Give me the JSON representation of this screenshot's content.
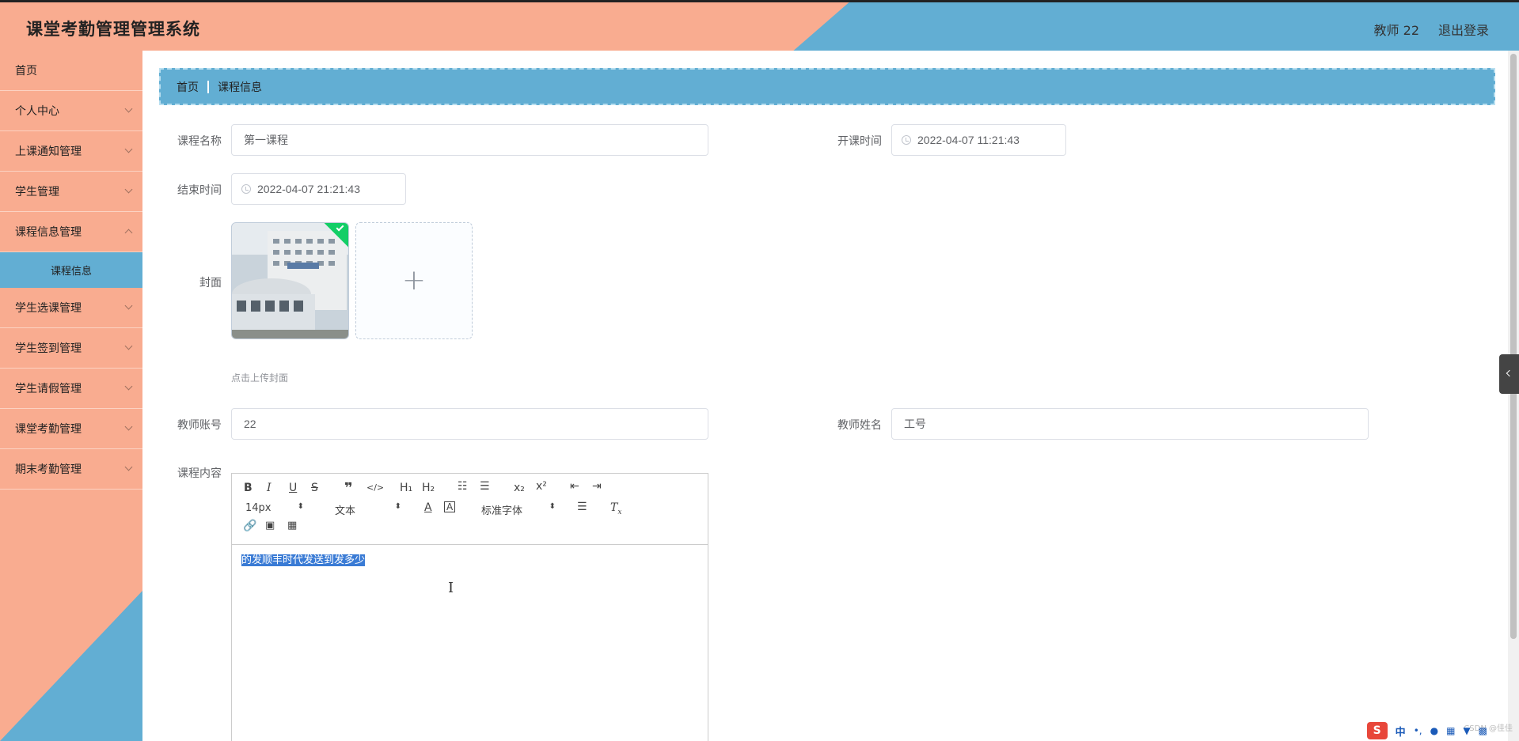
{
  "header": {
    "title": "课堂考勤管理管理系统",
    "user": "教师 22",
    "logout": "退出登录"
  },
  "sidebar": {
    "items": [
      {
        "label": "首页"
      },
      {
        "label": "个人中心"
      },
      {
        "label": "上课通知管理"
      },
      {
        "label": "学生管理"
      },
      {
        "label": "课程信息管理"
      },
      {
        "label": "学生选课管理"
      },
      {
        "label": "学生签到管理"
      },
      {
        "label": "学生请假管理"
      },
      {
        "label": "课堂考勤管理"
      },
      {
        "label": "期末考勤管理"
      }
    ],
    "submenu_active": "课程信息"
  },
  "breadcrumb": {
    "home": "首页",
    "current": "课程信息"
  },
  "form": {
    "course_name_label": "课程名称",
    "course_name_value": "第一课程",
    "start_time_label": "开课时间",
    "start_time_value": "2022-04-07 11:21:43",
    "end_time_label": "结束时间",
    "end_time_value": "2022-04-07 21:21:43",
    "cover_label": "封面",
    "cover_tip": "点击上传封面",
    "teacher_account_label": "教师账号",
    "teacher_account_value": "22",
    "teacher_name_label": "教师姓名",
    "teacher_name_value": "工号",
    "content_label": "课程内容"
  },
  "editor": {
    "font_size": "14px",
    "text_style": "文本",
    "font_family": "标准字体",
    "content": "的发顺丰时代发送到发多少"
  },
  "tray": {
    "ime": "中",
    "watermark": "CSDN @佳佳"
  },
  "colors": {
    "header_bg": "#f9ac90",
    "accent_blue": "#62aed3",
    "selected_text": "#3a7bd5"
  }
}
